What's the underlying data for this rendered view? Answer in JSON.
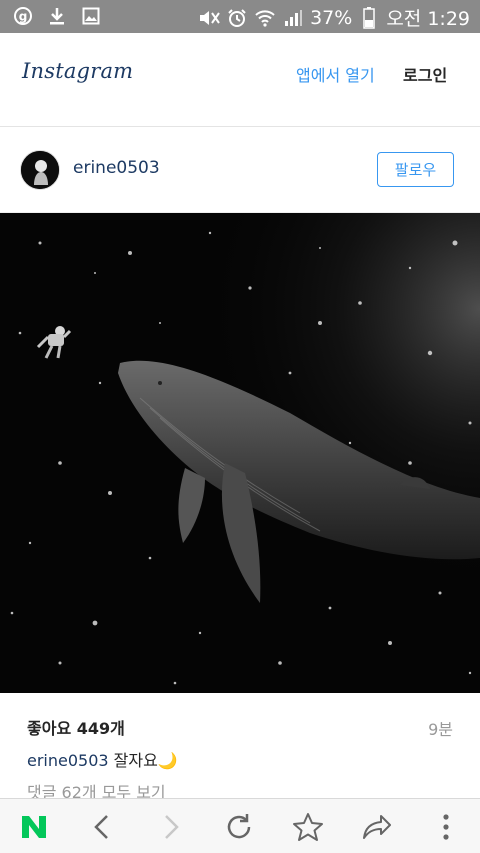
{
  "status_bar": {
    "battery_percent": "37%",
    "time": "오전 1:29",
    "left_icons": [
      "naver-notification-icon",
      "download-icon",
      "image-icon"
    ],
    "right_icons": [
      "mute-icon",
      "alarm-icon",
      "wifi-icon",
      "signal-icon",
      "battery-icon"
    ]
  },
  "header": {
    "logo": "Instagram",
    "open_app": "앱에서 열기",
    "login": "로그인"
  },
  "post": {
    "username": "erine0503",
    "follow": "팔로우",
    "likes": "좋아요 449개",
    "time_ago": "9분",
    "caption_user": "erine0503",
    "caption_text": "잘자요🌙",
    "comments_link": "댓글 62개 모두 보기"
  },
  "toolbar": {
    "items": [
      "naver-home-icon",
      "back-icon",
      "forward-icon",
      "refresh-icon",
      "bookmark-star-icon",
      "share-icon",
      "more-icon"
    ],
    "naver_label": "N"
  },
  "colors": {
    "status_bar": "#8a8a8a",
    "instagram_link_blue": "#3897f0",
    "username_navy": "#1d3a63",
    "naver_green": "#03c75a"
  }
}
